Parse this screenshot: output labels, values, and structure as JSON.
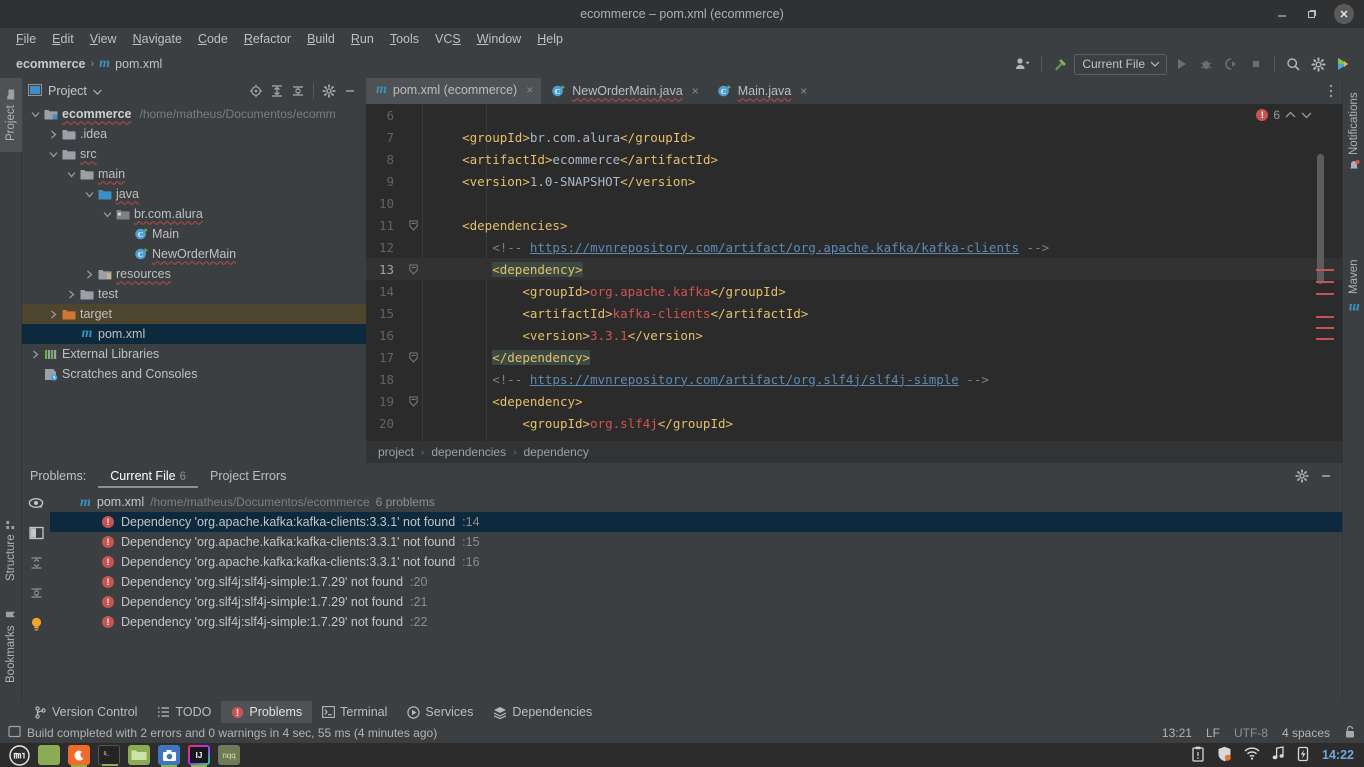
{
  "window": {
    "title": "ecommerce – pom.xml (ecommerce)",
    "minimize_label": "Minimize",
    "maximize_label": "Maximize",
    "close_label": "Close"
  },
  "menubar": {
    "items": [
      {
        "label": "File",
        "mnemonic": "F"
      },
      {
        "label": "Edit",
        "mnemonic": "E"
      },
      {
        "label": "View",
        "mnemonic": "V"
      },
      {
        "label": "Navigate",
        "mnemonic": "N"
      },
      {
        "label": "Code",
        "mnemonic": "C"
      },
      {
        "label": "Refactor",
        "mnemonic": "R"
      },
      {
        "label": "Build",
        "mnemonic": "B"
      },
      {
        "label": "Run",
        "mnemonic": "R"
      },
      {
        "label": "Tools",
        "mnemonic": "T"
      },
      {
        "label": "VCS",
        "mnemonic": "S"
      },
      {
        "label": "Window",
        "mnemonic": "W"
      },
      {
        "label": "Help",
        "mnemonic": "H"
      }
    ]
  },
  "navbar": {
    "project": "ecommerce",
    "separator": "›",
    "file": "pom.xml",
    "file_icon": "maven-m-icon",
    "run_config": "Current File",
    "toolbar_icons": [
      "user-avatar-icon",
      "hammer-build-icon",
      "run-icon",
      "debug-icon",
      "run-coverage-icon",
      "stop-icon",
      "search-everywhere-icon",
      "settings-gear-icon",
      "ide-feature-icon"
    ]
  },
  "left_stripe": {
    "tabs": [
      {
        "label": "Project",
        "icon": "folder-icon",
        "active": true
      },
      {
        "label": "Structure",
        "icon": "structure-icon",
        "active": false
      },
      {
        "label": "Bookmarks",
        "icon": "bookmark-icon",
        "active": false
      }
    ]
  },
  "right_stripe": {
    "tabs": [
      {
        "label": "Notifications",
        "icon": "bell-icon"
      },
      {
        "label": "Maven",
        "icon": "maven-m-icon"
      }
    ]
  },
  "project_panel": {
    "title": "Project",
    "tools": [
      "locate-icon",
      "expand-all-icon",
      "collapse-all-icon",
      "settings-gear-icon",
      "hide-icon"
    ],
    "tree": [
      {
        "label": "ecommerce",
        "path": "/home/matheus/Documentos/ecomm",
        "indent": 0,
        "arrow": "v",
        "icon": "module-folder-icon",
        "bold": true,
        "state": "normal"
      },
      {
        "label": ".idea",
        "path": "",
        "indent": 1,
        "arrow": ">",
        "icon": "folder-icon",
        "bold": false,
        "state": "normal"
      },
      {
        "label": "src",
        "path": "",
        "indent": 1,
        "arrow": "v",
        "icon": "folder-icon",
        "bold": false,
        "state": "normal"
      },
      {
        "label": "main",
        "path": "",
        "indent": 2,
        "arrow": "v",
        "icon": "folder-icon",
        "bold": false,
        "state": "normal"
      },
      {
        "label": "java",
        "path": "",
        "indent": 3,
        "arrow": "v",
        "icon": "source-folder-icon",
        "bold": false,
        "state": "normal"
      },
      {
        "label": "br.com.alura",
        "path": "",
        "indent": 4,
        "arrow": "v",
        "icon": "package-icon",
        "bold": false,
        "state": "normal"
      },
      {
        "label": "Main",
        "path": "",
        "indent": 5,
        "arrow": "",
        "icon": "java-class-run-icon",
        "bold": false,
        "state": "normal"
      },
      {
        "label": "NewOrderMain",
        "path": "",
        "indent": 5,
        "arrow": "",
        "icon": "java-class-run-icon",
        "bold": false,
        "state": "normal"
      },
      {
        "label": "resources",
        "path": "",
        "indent": 3,
        "arrow": ">",
        "icon": "resources-folder-icon",
        "bold": false,
        "state": "normal"
      },
      {
        "label": "test",
        "path": "",
        "indent": 2,
        "arrow": ">",
        "icon": "folder-icon",
        "bold": false,
        "state": "normal"
      },
      {
        "label": "target",
        "path": "",
        "indent": 1,
        "arrow": ">",
        "icon": "excluded-folder-icon",
        "bold": false,
        "state": "target"
      },
      {
        "label": "pom.xml",
        "path": "",
        "indent": 2,
        "arrow": "",
        "icon": "maven-m-icon",
        "bold": false,
        "state": "selected"
      },
      {
        "label": "External Libraries",
        "path": "",
        "indent": 0,
        "arrow": ">",
        "icon": "libraries-icon",
        "bold": false,
        "state": "normal"
      },
      {
        "label": "Scratches and Consoles",
        "path": "",
        "indent": 0,
        "arrow": "",
        "icon": "scratches-icon",
        "bold": false,
        "state": "normal"
      }
    ]
  },
  "editor": {
    "tabs": [
      {
        "label": "pom.xml (ecommerce)",
        "icon": "maven-m-icon",
        "active": true
      },
      {
        "label": "NewOrderMain.java",
        "icon": "java-class-run-icon",
        "active": false
      },
      {
        "label": "Main.java",
        "icon": "java-class-run-icon",
        "active": false
      }
    ],
    "inspection": {
      "error_count": "6",
      "up_label": "Previous problem",
      "down_label": "Next problem"
    },
    "breadcrumb": [
      "project",
      "dependencies",
      "dependency"
    ],
    "lines": [
      {
        "no": "6",
        "fold": "",
        "current": false,
        "segments": []
      },
      {
        "no": "7",
        "fold": "",
        "current": false,
        "segments": [
          {
            "t": "    ",
            "c": "txt"
          },
          {
            "t": "<groupId>",
            "c": "tag"
          },
          {
            "t": "br.com.alura",
            "c": "txt"
          },
          {
            "t": "</groupId>",
            "c": "tag"
          }
        ]
      },
      {
        "no": "8",
        "fold": "",
        "current": false,
        "segments": [
          {
            "t": "    ",
            "c": "txt"
          },
          {
            "t": "<artifactId>",
            "c": "tag"
          },
          {
            "t": "ecommerce",
            "c": "txt"
          },
          {
            "t": "</artifactId>",
            "c": "tag"
          }
        ]
      },
      {
        "no": "9",
        "fold": "",
        "current": false,
        "segments": [
          {
            "t": "    ",
            "c": "txt"
          },
          {
            "t": "<version>",
            "c": "tag"
          },
          {
            "t": "1.0-SNAPSHOT",
            "c": "txt"
          },
          {
            "t": "</version>",
            "c": "tag"
          }
        ]
      },
      {
        "no": "10",
        "fold": "",
        "current": false,
        "segments": []
      },
      {
        "no": "11",
        "fold": "-",
        "current": false,
        "segments": [
          {
            "t": "    ",
            "c": "txt"
          },
          {
            "t": "<dependencies>",
            "c": "tag"
          }
        ]
      },
      {
        "no": "12",
        "fold": "",
        "current": false,
        "segments": [
          {
            "t": "        ",
            "c": "txt"
          },
          {
            "t": "<!-- ",
            "c": "cmt"
          },
          {
            "t": "https://mvnrepository.com/artifact/org.apache.kafka/kafka-clients",
            "c": "lnk"
          },
          {
            "t": " -->",
            "c": "cmt"
          }
        ]
      },
      {
        "no": "13",
        "fold": "-",
        "current": true,
        "segments": [
          {
            "t": "        ",
            "c": "txt"
          },
          {
            "t": "<dependency>",
            "c": "tag hl"
          }
        ]
      },
      {
        "no": "14",
        "fold": "",
        "current": false,
        "segments": [
          {
            "t": "            ",
            "c": "txt"
          },
          {
            "t": "<groupId>",
            "c": "tag"
          },
          {
            "t": "org.apache.kafka",
            "c": "redv"
          },
          {
            "t": "</groupId>",
            "c": "tag"
          }
        ]
      },
      {
        "no": "15",
        "fold": "",
        "current": false,
        "segments": [
          {
            "t": "            ",
            "c": "txt"
          },
          {
            "t": "<artifactId>",
            "c": "tag"
          },
          {
            "t": "kafka-clients",
            "c": "redv"
          },
          {
            "t": "</artifactId>",
            "c": "tag"
          }
        ]
      },
      {
        "no": "16",
        "fold": "",
        "current": false,
        "segments": [
          {
            "t": "            ",
            "c": "txt"
          },
          {
            "t": "<version>",
            "c": "tag"
          },
          {
            "t": "3.3.1",
            "c": "redv"
          },
          {
            "t": "</version>",
            "c": "tag"
          }
        ]
      },
      {
        "no": "17",
        "fold": "-",
        "current": false,
        "segments": [
          {
            "t": "        ",
            "c": "txt"
          },
          {
            "t": "</dependency>",
            "c": "tag hl"
          }
        ]
      },
      {
        "no": "18",
        "fold": "",
        "current": false,
        "segments": [
          {
            "t": "        ",
            "c": "txt"
          },
          {
            "t": "<!-- ",
            "c": "cmt"
          },
          {
            "t": "https://mvnrepository.com/artifact/org.slf4j/slf4j-simple",
            "c": "lnk"
          },
          {
            "t": " -->",
            "c": "cmt"
          }
        ]
      },
      {
        "no": "19",
        "fold": "-",
        "current": false,
        "segments": [
          {
            "t": "        ",
            "c": "txt"
          },
          {
            "t": "<dependency>",
            "c": "tag"
          }
        ]
      },
      {
        "no": "20",
        "fold": "",
        "current": false,
        "segments": [
          {
            "t": "            ",
            "c": "txt"
          },
          {
            "t": "<groupId>",
            "c": "tag"
          },
          {
            "t": "org.slf4j",
            "c": "redv"
          },
          {
            "t": "</groupId>",
            "c": "tag"
          }
        ]
      }
    ]
  },
  "problems_panel": {
    "label": "Problems:",
    "tabs": [
      {
        "label": "Current File",
        "count": "6",
        "active": true
      },
      {
        "label": "Project Errors",
        "count": "",
        "active": false
      }
    ],
    "tools": [
      "settings-gear-icon",
      "hide-icon"
    ],
    "side_tools": [
      "preview-eye-icon",
      "split-mode-icon",
      "expand-all-icon",
      "collapse-all-icon",
      "lightbulb-icon"
    ],
    "file": {
      "name": "pom.xml",
      "path": "/home/matheus/Documentos/ecommerce",
      "count": "6 problems",
      "icon": "maven-m-icon"
    },
    "rows": [
      {
        "message": "Dependency 'org.apache.kafka:kafka-clients:3.3.1' not found",
        "line": ":14",
        "selected": true
      },
      {
        "message": "Dependency 'org.apache.kafka:kafka-clients:3.3.1' not found",
        "line": ":15",
        "selected": false
      },
      {
        "message": "Dependency 'org.apache.kafka:kafka-clients:3.3.1' not found",
        "line": ":16",
        "selected": false
      },
      {
        "message": "Dependency 'org.slf4j:slf4j-simple:1.7.29' not found",
        "line": ":20",
        "selected": false
      },
      {
        "message": "Dependency 'org.slf4j:slf4j-simple:1.7.29' not found",
        "line": ":21",
        "selected": false
      },
      {
        "message": "Dependency 'org.slf4j:slf4j-simple:1.7.29' not found",
        "line": ":22",
        "selected": false
      }
    ]
  },
  "bottom_tabs": [
    {
      "label": "Version Control",
      "icon": "branch-icon",
      "active": false
    },
    {
      "label": "TODO",
      "icon": "todo-list-icon",
      "active": false
    },
    {
      "label": "Problems",
      "icon": "error-circle-icon",
      "active": true
    },
    {
      "label": "Terminal",
      "icon": "terminal-icon",
      "active": false
    },
    {
      "label": "Services",
      "icon": "services-play-icon",
      "active": false
    },
    {
      "label": "Dependencies",
      "icon": "layers-icon",
      "active": false
    }
  ],
  "statusbar": {
    "icon": "build-status-icon",
    "message": "Build completed with 2 errors and 0 warnings in 4 sec, 55 ms (4 minutes ago)",
    "cursor_position": "13:21",
    "line_separator": "LF",
    "encoding": "UTF-8",
    "indent": "4 spaces",
    "lock_icon": "read-write-lock-icon"
  },
  "taskbar": {
    "start_label": "Linux Mint Menu",
    "apps": [
      {
        "name": "window-list-item",
        "color": "#8bab54",
        "running": false
      },
      {
        "name": "firefox",
        "color": "#f06a2a",
        "running": true
      },
      {
        "name": "terminal",
        "color": "#2a2a2a",
        "running": true
      },
      {
        "name": "files",
        "color": "#8bab54",
        "running": false
      },
      {
        "name": "screenshot",
        "color": "#3d77c2",
        "running": true
      },
      {
        "name": "intellij-idea",
        "color": "#1b1b2a",
        "running": true
      },
      {
        "name": "nqq-editor",
        "color": "#6f7a56",
        "running": false
      }
    ],
    "tray": [
      "clipboard-icon",
      "shield-update-icon",
      "wifi-icon",
      "volume-music-icon",
      "battery-charging-icon"
    ],
    "clock": "14:22"
  }
}
